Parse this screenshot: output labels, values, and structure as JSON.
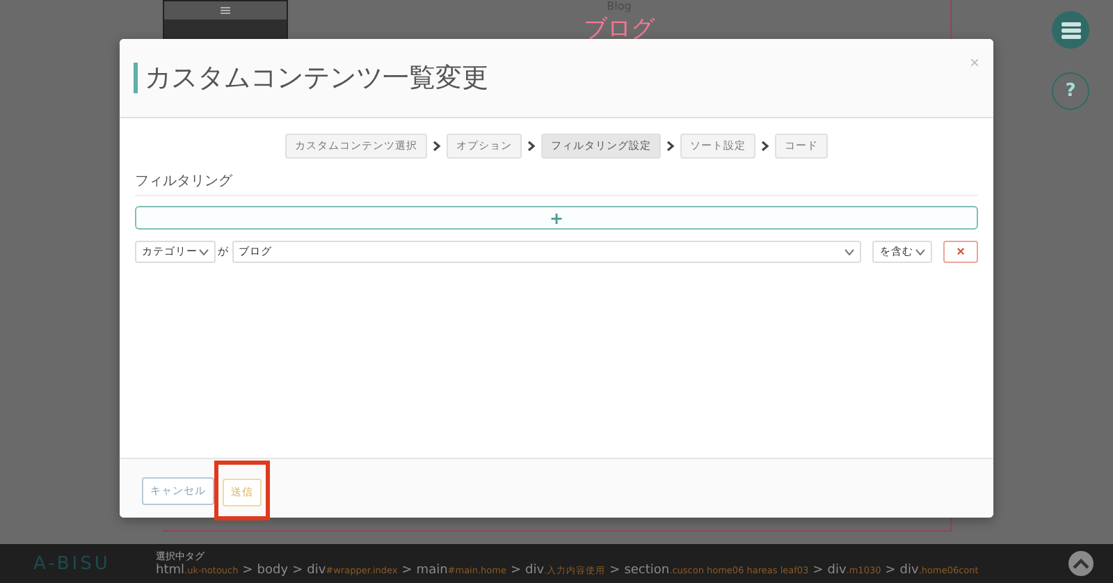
{
  "page": {
    "menu_glyph": "≡",
    "subtitle": "Blog",
    "title": "ブログ"
  },
  "side_buttons": [
    {
      "kind": "menu"
    },
    {
      "kind": "help",
      "label": "?"
    }
  ],
  "modal": {
    "title": "カスタムコンテンツ一覧変更",
    "close": "×",
    "steps": [
      {
        "label": "カスタムコンテンツ選択",
        "selected": false
      },
      {
        "label": "オプション",
        "selected": false
      },
      {
        "label": "フィルタリング設定",
        "selected": true
      },
      {
        "label": "ソート設定",
        "selected": false
      },
      {
        "label": "コード",
        "selected": false
      }
    ],
    "section_title": "フィルタリング",
    "add_button": "+",
    "filter": {
      "field": "カテゴリー",
      "particle": "が",
      "value": "ブログ",
      "operator": "を含む",
      "remove": "×"
    },
    "buttons": [
      {
        "label": "キャンセル",
        "kind": "cancel",
        "highlighted": false
      },
      {
        "label": "送信",
        "kind": "submit",
        "highlighted": true
      }
    ]
  },
  "footer": {
    "logo": "A-BISU",
    "label": "選択中タグ",
    "path": [
      {
        "tag": "html",
        "cls": ".uk-notouch"
      },
      {
        "sep": ">",
        "tag": "body"
      },
      {
        "sep": ">",
        "tag": "div",
        "cls": "#wrapper.index"
      },
      {
        "sep": ">",
        "tag": "main",
        "cls": "#main.home"
      },
      {
        "sep": ">",
        "tag": "div",
        "cls": ".入力内容使用"
      },
      {
        "sep": ">",
        "tag": "section",
        "cls": ".cuscon home06 hareas leaf03"
      },
      {
        "sep": ">",
        "tag": "div",
        "cls": ".m1030"
      },
      {
        "sep": ">",
        "tag": "div",
        "cls": ".home06cont"
      }
    ]
  }
}
